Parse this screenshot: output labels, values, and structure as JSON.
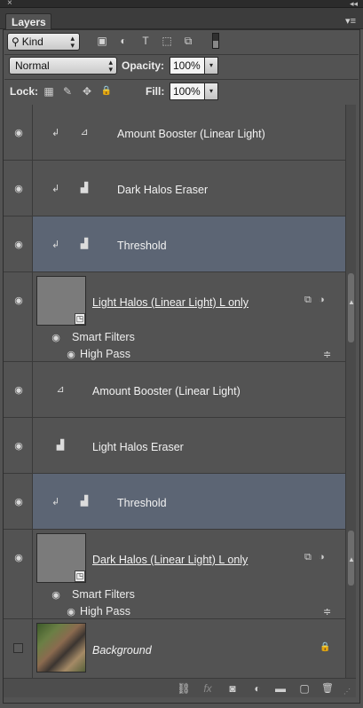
{
  "window": {
    "close_glyph": "×",
    "collapse_glyph": "◂◂"
  },
  "tab": {
    "label": "Layers",
    "menu_glyph": "▾≡"
  },
  "filter": {
    "kind_label": "Kind",
    "icons": [
      "image-filter-icon",
      "adjustment-filter-icon",
      "type-filter-icon",
      "shape-filter-icon",
      "smart-object-filter-icon"
    ],
    "icon_glyphs": [
      "▣",
      "◐",
      "T",
      "⬚",
      "⧉"
    ]
  },
  "blend": {
    "mode": "Normal",
    "opacity_label": "Opacity:",
    "opacity_value": "100%"
  },
  "lock": {
    "label": "Lock:",
    "fill_label": "Fill:",
    "fill_value": "100%",
    "icons": [
      "lock-transparent-icon",
      "lock-image-icon",
      "lock-position-icon",
      "lock-all-icon"
    ],
    "icon_glyphs": [
      "▦",
      "✎",
      "✥",
      "🔒"
    ]
  },
  "layers": [
    {
      "name": "Amount Booster (Linear Light)",
      "type": "curves",
      "clipped": true,
      "selected": false
    },
    {
      "name": "Dark Halos Eraser",
      "type": "levels",
      "clipped": true,
      "selected": false
    },
    {
      "name": "Threshold",
      "type": "levels",
      "clipped": true,
      "selected": true
    },
    {
      "name": "Light Halos (Linear Light) L only",
      "type": "smart-object",
      "smart_filters_label": "Smart Filters",
      "filter_name": "High Pass"
    },
    {
      "name": "Amount Booster (Linear Light)",
      "type": "curves",
      "clipped": false,
      "selected": false
    },
    {
      "name": "Light Halos Eraser",
      "type": "levels",
      "clipped": false,
      "selected": false
    },
    {
      "name": "Threshold",
      "type": "levels",
      "clipped": true,
      "selected": true
    },
    {
      "name": "Dark Halos (Linear Light) L only",
      "type": "smart-object",
      "smart_filters_label": "Smart Filters",
      "filter_name": "High Pass"
    },
    {
      "name": "Background",
      "type": "background",
      "locked": true
    }
  ],
  "bottom": {
    "icons": [
      "link-layers-icon",
      "fx-icon",
      "add-mask-icon",
      "new-adjustment-icon",
      "new-group-icon",
      "new-layer-icon",
      "delete-icon"
    ],
    "glyphs": [
      "⛓",
      "fx",
      "◙",
      "◐",
      "▬",
      "▢",
      "🗑"
    ]
  },
  "colors": {
    "panel": "#535353",
    "selected_row": "#5c6574",
    "dark": "#2b2b2b"
  }
}
